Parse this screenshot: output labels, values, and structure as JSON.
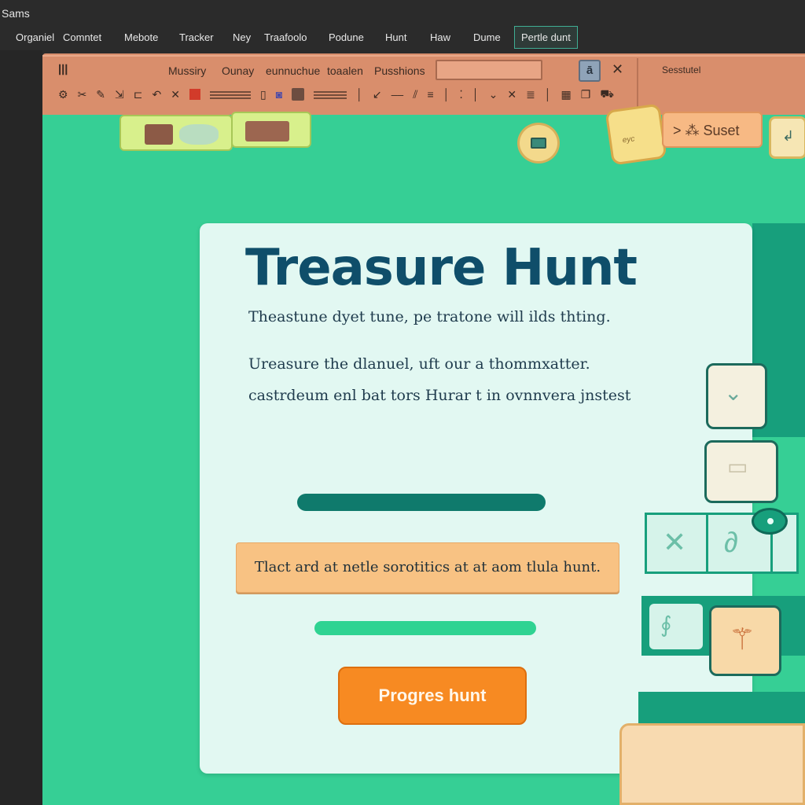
{
  "window": {
    "title": "Sams"
  },
  "menu": {
    "items": [
      {
        "label": "Organiel"
      },
      {
        "label": "Comntet"
      },
      {
        "label": "Mebote"
      },
      {
        "label": "Tracker"
      },
      {
        "label": "Ney"
      },
      {
        "label": "Traafoolo"
      },
      {
        "label": "Podune"
      },
      {
        "label": "Hunt"
      },
      {
        "label": "Haw"
      },
      {
        "label": "Dume"
      }
    ],
    "active_label": "Pertle dunt"
  },
  "ribbon": {
    "left_label": "ꟾꟾꟾ",
    "labels": [
      "Mussiry",
      "Ounay",
      "eunnuchue",
      "toaalen",
      "Pusshions"
    ],
    "right_label": "Sesstutel",
    "search_value": ""
  },
  "canvas": {
    "cube_label": "eyc",
    "peach_tab_label": "> ⁂ Suset",
    "small_tab_label": "↲"
  },
  "card": {
    "title": "Treasure Hunt",
    "subtitle": "Theastune dyet tune, pe tratone will ilds thting.",
    "para_line1": "Ureasure the dlanuel, uft our a thommxatter.",
    "para_line2": "castrdeum enl bat tors Hurar t in ovnnvera jnstest",
    "banner_text": "Tlact ard at netle sorotitics at at aom tlula hunt.",
    "button_label": "Progres hunt",
    "progress_dark": 1.0,
    "progress_green": 1.0
  },
  "colors": {
    "canvas": "#36cf95",
    "ribbon": "#d98e6c",
    "accent_teal": "#179f7c",
    "button_orange": "#f78a22",
    "title_navy": "#0f4e6a"
  }
}
